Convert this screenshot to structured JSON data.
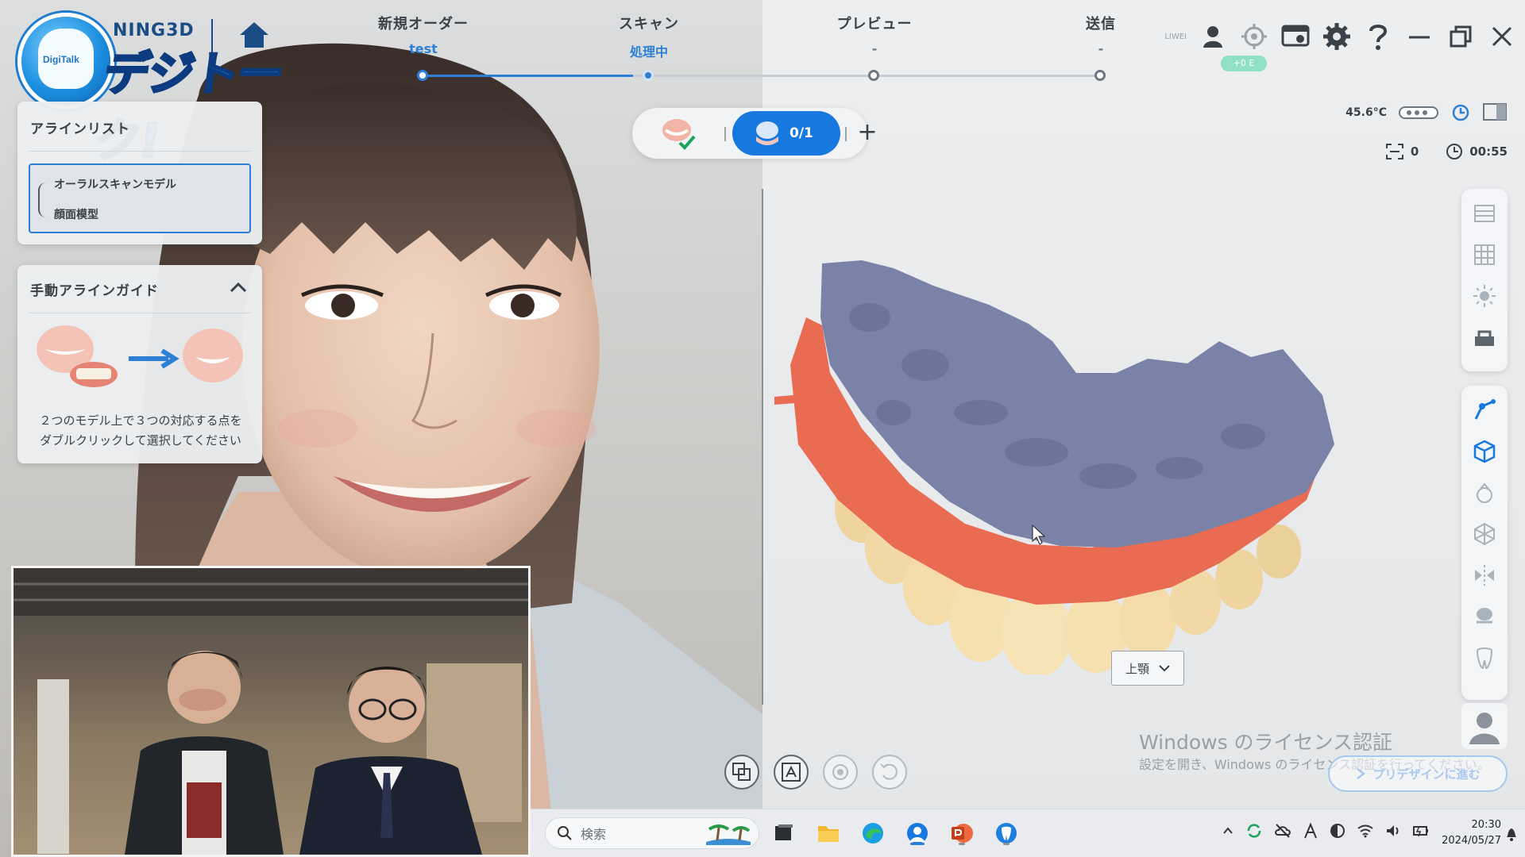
{
  "app": {
    "brand_fragment": "NING3D",
    "overlay_logo_text": "デジトーク!",
    "overlay_logo_tag": "DigiTalk"
  },
  "steps": [
    {
      "title": "新規オーダー",
      "sub": "test",
      "state": "done"
    },
    {
      "title": "スキャン",
      "sub": "処理中",
      "state": "current"
    },
    {
      "title": "プレビュー",
      "sub": "-",
      "state": "todo"
    },
    {
      "title": "送信",
      "sub": "-",
      "state": "todo"
    }
  ],
  "progress": 0.31,
  "topbar": {
    "user_tag": "LIWEI",
    "badge": "+0 E",
    "icons": [
      "user-icon",
      "target-icon",
      "screen-capture-icon",
      "gear-icon",
      "help-icon",
      "minimize-icon",
      "restore-icon",
      "close-icon"
    ]
  },
  "scan_toolbar": {
    "count": "0/1",
    "add_label": "+"
  },
  "status": {
    "temperature": "45.6°C",
    "scan_count": "0",
    "timer": "00:55"
  },
  "align_list": {
    "title": "アラインリスト",
    "items": [
      "オーラルスキャンモデル",
      "顔面模型"
    ]
  },
  "manual_guide": {
    "title": "手動アラインガイド",
    "instruction_line1": "２つのモデル上で３つの対応する点を",
    "instruction_line2": "ダブルクリックして選択してください"
  },
  "jaw_select": {
    "value": "上顎"
  },
  "windows": {
    "watermark_title": "Windows のライセンス認証",
    "watermark_sub": "設定を開き、Windows のライセンス認証を行ってください。"
  },
  "next_button": "プリデザインに進む",
  "taskbar": {
    "search_placeholder": "検索",
    "time": "20:30",
    "date": "2024/05/27"
  },
  "colors": {
    "accent": "#1778e0",
    "jaw_palate": "#7b82a8",
    "jaw_gum": "#e86b52",
    "jaw_tooth": "#f0d7a0"
  }
}
